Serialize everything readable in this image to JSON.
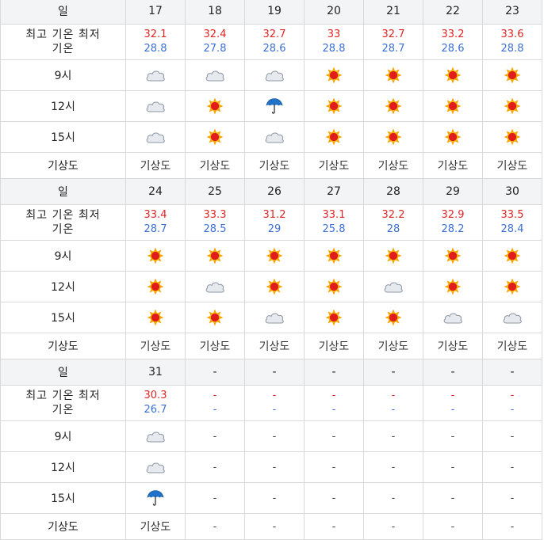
{
  "labels": {
    "day": "일",
    "temp_line1": "최고 기온 최저",
    "temp_line2": "기온",
    "h9": "9시",
    "h12": "12시",
    "h15": "15시",
    "map": "기상도"
  },
  "placeholder": "-",
  "weeks": [
    {
      "days": [
        {
          "day": "17",
          "hi": "32.1",
          "lo": "28.8",
          "h9": "cloud",
          "h12": "cloud",
          "h15": "cloud",
          "map": "기상도"
        },
        {
          "day": "18",
          "hi": "32.4",
          "lo": "27.8",
          "h9": "cloud",
          "h12": "sun",
          "h15": "sun",
          "map": "기상도"
        },
        {
          "day": "19",
          "hi": "32.7",
          "lo": "28.6",
          "h9": "cloud",
          "h12": "umbrella",
          "h15": "cloud",
          "map": "기상도"
        },
        {
          "day": "20",
          "hi": "33",
          "lo": "28.8",
          "h9": "sun",
          "h12": "sun",
          "h15": "sun",
          "map": "기상도"
        },
        {
          "day": "21",
          "hi": "32.7",
          "lo": "28.7",
          "h9": "sun",
          "h12": "sun",
          "h15": "sun",
          "map": "기상도"
        },
        {
          "day": "22",
          "hi": "33.2",
          "lo": "28.6",
          "h9": "sun",
          "h12": "sun",
          "h15": "sun",
          "map": "기상도"
        },
        {
          "day": "23",
          "hi": "33.6",
          "lo": "28.8",
          "h9": "sun",
          "h12": "sun",
          "h15": "sun",
          "map": "기상도"
        }
      ]
    },
    {
      "days": [
        {
          "day": "24",
          "hi": "33.4",
          "lo": "28.7",
          "h9": "sun",
          "h12": "sun",
          "h15": "sun",
          "map": "기상도"
        },
        {
          "day": "25",
          "hi": "33.3",
          "lo": "28.5",
          "h9": "sun",
          "h12": "cloud",
          "h15": "sun",
          "map": "기상도"
        },
        {
          "day": "26",
          "hi": "31.2",
          "lo": "29",
          "h9": "sun",
          "h12": "sun",
          "h15": "cloud",
          "map": "기상도"
        },
        {
          "day": "27",
          "hi": "33.1",
          "lo": "25.8",
          "h9": "sun",
          "h12": "sun",
          "h15": "sun",
          "map": "기상도"
        },
        {
          "day": "28",
          "hi": "32.2",
          "lo": "28",
          "h9": "sun",
          "h12": "cloud",
          "h15": "sun",
          "map": "기상도"
        },
        {
          "day": "29",
          "hi": "32.9",
          "lo": "28.2",
          "h9": "sun",
          "h12": "sun",
          "h15": "cloud",
          "map": "기상도"
        },
        {
          "day": "30",
          "hi": "33.5",
          "lo": "28.4",
          "h9": "sun",
          "h12": "sun",
          "h15": "cloud",
          "map": "기상도"
        }
      ]
    },
    {
      "days": [
        {
          "day": "31",
          "hi": "30.3",
          "lo": "26.7",
          "h9": "cloud",
          "h12": "cloud",
          "h15": "umbrella",
          "map": "기상도"
        },
        {
          "day": "-",
          "hi": "-",
          "lo": "-",
          "h9": "-",
          "h12": "-",
          "h15": "-",
          "map": "-"
        },
        {
          "day": "-",
          "hi": "-",
          "lo": "-",
          "h9": "-",
          "h12": "-",
          "h15": "-",
          "map": "-"
        },
        {
          "day": "-",
          "hi": "-",
          "lo": "-",
          "h9": "-",
          "h12": "-",
          "h15": "-",
          "map": "-"
        },
        {
          "day": "-",
          "hi": "-",
          "lo": "-",
          "h9": "-",
          "h12": "-",
          "h15": "-",
          "map": "-"
        },
        {
          "day": "-",
          "hi": "-",
          "lo": "-",
          "h9": "-",
          "h12": "-",
          "h15": "-",
          "map": "-"
        },
        {
          "day": "-",
          "hi": "-",
          "lo": "-",
          "h9": "-",
          "h12": "-",
          "h15": "-",
          "map": "-"
        }
      ]
    }
  ],
  "icons": {
    "sun": "sun-icon",
    "cloud": "cloud-icon",
    "umbrella": "umbrella-icon"
  },
  "colors": {
    "high_temp": "#e02424",
    "low_temp": "#3b6fd6",
    "header_bg": "#f3f4f6",
    "border": "#d9d9d9"
  }
}
